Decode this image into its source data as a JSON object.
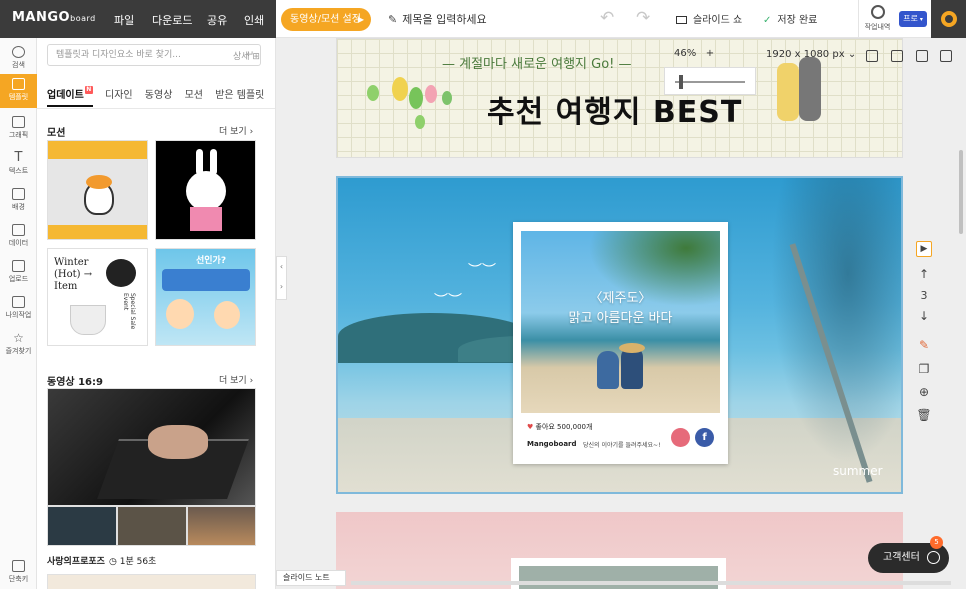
{
  "topbar": {
    "logo": "MANGO",
    "logo_sub": "board",
    "menu": [
      "파일",
      "다운로드",
      "공유",
      "인쇄"
    ],
    "video_motion_button": "동영상/모션 설정",
    "title_placeholder": "제목을 입력하세요",
    "slideshow": "슬라이드 쇼",
    "save_status": "저장 완료",
    "history_label": "작업내역",
    "plan_badge": "프로"
  },
  "rail": {
    "items": [
      "검색",
      "템플릿",
      "그래픽",
      "텍스트",
      "배경",
      "데이터",
      "업로드",
      "나의작업",
      "즐겨찾기"
    ],
    "shortcut": "단축키"
  },
  "panel": {
    "search_placeholder": "템플릿과 디자인요소 바로 찾기...",
    "detail": "상세",
    "tabs": [
      "업데이트",
      "디자인",
      "동영상",
      "모션",
      "받은 템플릿"
    ],
    "new_badge": "N",
    "section_motion": "모션",
    "section_video": "동영상 16:9",
    "more": "더 보기",
    "thumb_winter": "Winter (Hot) → Item",
    "thumb_special": "Special Sale Event",
    "thumb_banner": "선인가?",
    "video_title": "사랑의프로포즈",
    "video_duration": "1분 56초"
  },
  "canvas": {
    "zoom": "46%",
    "size": "1920 x 1080 px",
    "slide1_subtitle": "— 계절마다 새로운 여행지 Go! —",
    "slide1_title": "추천 여행지 BEST",
    "card_title_1": "〈제주도〉",
    "card_title_2": "맑고 아름다운 바다",
    "likes": "좋아요 500,000개",
    "account": "Mangoboard",
    "caption": "당신의 이야기를 들려주세요~!",
    "slide_brand": "summer",
    "slide_number": "3",
    "slide_note": "슬라이드 노트",
    "help": "고객센터",
    "help_count": "5"
  }
}
